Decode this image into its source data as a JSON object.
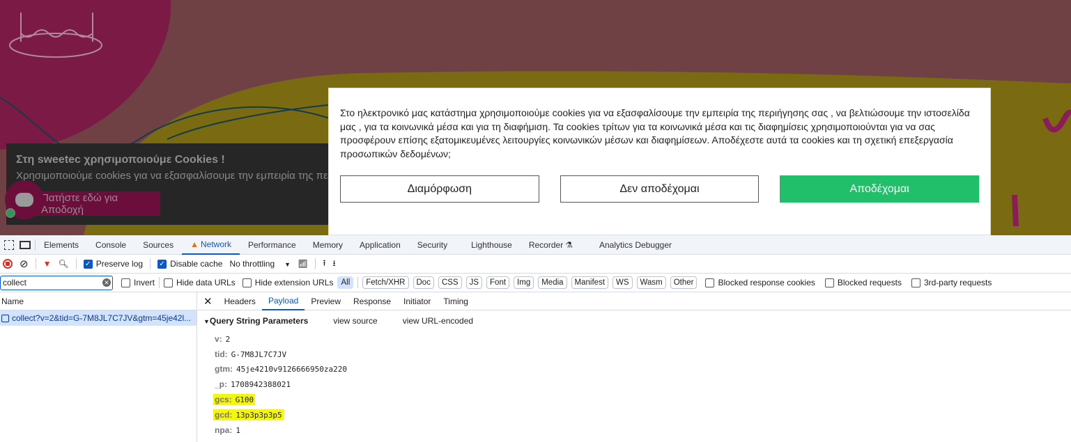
{
  "consent_modal": {
    "text": "Στο ηλεκτρονικό μας κατάστημα χρησιμοποιούμε  cookies για να εξασφαλίσουμε την εμπειρία της περιήγησης σας ,  να βελτιώσουμε την ιστοσελίδα μας , για τα  κοινωνικά μέσα και για τη διαφήμιση. Τα cookies τρίτων για τα κοινωνικά μέσα και τις διαφημίσεις χρησιμοποιούνται για να σας προσφέρουν επίσης εξατομικευμένες λειτουργίες κοινωνικών μέσων και διαφημίσεων. Αποδέχεστε αυτά τα cookies και τη σχετική επεξεργασία προσωπικών δεδομένων;",
    "configure": "Διαμόρφωση",
    "reject": "Δεν αποδέχομαι",
    "accept": "Αποδέχομαι",
    "accent": "#22bf6b"
  },
  "site_banner": {
    "title": "Στη sweetec χρησιμοποιούμε Cookies !",
    "text": "Χρησιμοποιούμε cookies για να εξασφαλίσουμε την εμπειρία της περιήγησης σας",
    "button": "Πατήστε εδώ για Αποδοχή"
  },
  "devtools": {
    "tabs": [
      "Elements",
      "Console",
      "Sources",
      "Network",
      "Performance",
      "Memory",
      "Application",
      "Security",
      "Lighthouse",
      "Recorder",
      "Analytics Debugger"
    ],
    "toolbar": {
      "preserve_log": "Preserve log",
      "disable_cache": "Disable cache",
      "throttling": "No throttling"
    },
    "filter": {
      "value": "collect",
      "invert": "Invert",
      "hide_data": "Hide data URLs",
      "hide_ext": "Hide extension URLs",
      "types": [
        "All",
        "Fetch/XHR",
        "Doc",
        "CSS",
        "JS",
        "Font",
        "Img",
        "Media",
        "Manifest",
        "WS",
        "Wasm",
        "Other"
      ],
      "blocked_cookies": "Blocked response cookies",
      "blocked_requests": "Blocked requests",
      "third_party": "3rd-party requests"
    },
    "name_header": "Name",
    "request": "collect?v=2&tid=G-7M8JL7C7JV&gtm=45je42l...",
    "detail_tabs": [
      "Headers",
      "Payload",
      "Preview",
      "Response",
      "Initiator",
      "Timing"
    ],
    "qs_title": "Query String Parameters",
    "view_source": "view source",
    "view_encoded": "view URL-encoded",
    "params": [
      {
        "k": "v:",
        "v": "2"
      },
      {
        "k": "tid:",
        "v": "G-7M8JL7C7JV"
      },
      {
        "k": "gtm:",
        "v": "45je4210v9126666950za220"
      },
      {
        "k": "_p:",
        "v": "1708942388021"
      },
      {
        "k": "gcs:",
        "v": "G100"
      },
      {
        "k": "gcd:",
        "v": "13p3p3p3p5"
      },
      {
        "k": "npa:",
        "v": "1"
      }
    ]
  }
}
